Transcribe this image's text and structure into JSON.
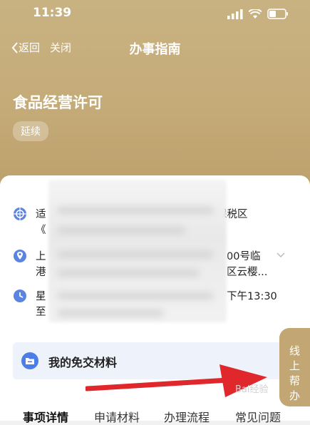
{
  "status_bar": {
    "time": "11:39"
  },
  "nav": {
    "back_label": "返回",
    "close_label": "关闭",
    "title": "办事指南"
  },
  "service": {
    "title": "食品经营许可",
    "tag": "延续"
  },
  "info": {
    "scope_line1_start": "适",
    "scope_line1_end": "保税区",
    "scope_line2_start": "《",
    "address_line1_start": "上",
    "address_line1_end": "00号临",
    "address_line2_start": "港",
    "address_line2_end": "区云樱...",
    "hours_line1_start": "星",
    "hours_line1_end": "下午13:30",
    "hours_line2_start": "至"
  },
  "materials": {
    "label": "我的免交材料"
  },
  "online_help": {
    "chars": [
      "线",
      "上",
      "帮",
      "办"
    ]
  },
  "tabs": [
    "事项详情",
    "申请材料",
    "办理流程",
    "常见问题"
  ],
  "watermark": "Bai经验",
  "colors": {
    "header_gold": "#c4ab78",
    "accent_blue": "#4a7ee6",
    "arrow_red": "#e0272b"
  }
}
